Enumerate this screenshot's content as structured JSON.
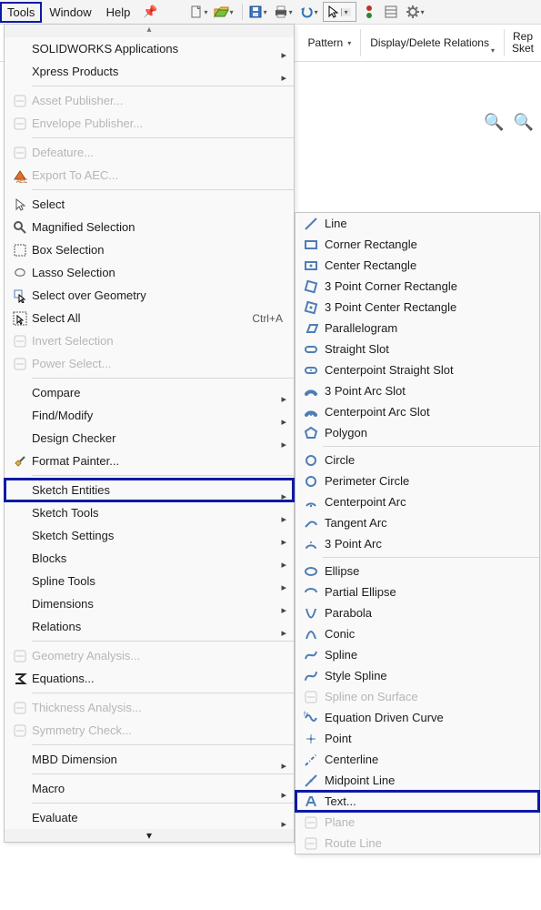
{
  "menubar": {
    "items": [
      "Tools",
      "Window",
      "Help"
    ],
    "selected_index": 0
  },
  "ribbon": {
    "pattern_label": "Pattern",
    "ddr_label": "Display/Delete Relations",
    "repair_top": "Rep",
    "repair_bottom": "Sket"
  },
  "tools_menu": {
    "scroll_up": "▴",
    "scroll_dn": "▾",
    "groups": [
      [
        {
          "label": "SOLIDWORKS Applications",
          "submenu": true
        },
        {
          "label": "Xpress Products",
          "submenu": true
        }
      ],
      [
        {
          "label": "Asset Publisher...",
          "disabled": true,
          "icon": "asset-publisher-icon"
        },
        {
          "label": "Envelope Publisher...",
          "disabled": true,
          "icon": "envelope-publisher-icon"
        }
      ],
      [
        {
          "label": "Defeature...",
          "disabled": true,
          "icon": "defeature-icon"
        },
        {
          "label": "Export To AEC...",
          "disabled": true,
          "icon": "export-aec-icon"
        }
      ],
      [
        {
          "label": "Select",
          "icon": "cursor-icon"
        },
        {
          "label": "Magnified Selection",
          "icon": "magnify-icon"
        },
        {
          "label": "Box Selection",
          "icon": "box-select-icon"
        },
        {
          "label": "Lasso Selection",
          "icon": "lasso-icon"
        },
        {
          "label": "Select over Geometry",
          "icon": "select-geometry-icon"
        },
        {
          "label": "Select All",
          "icon": "select-all-icon",
          "shortcut": "Ctrl+A"
        },
        {
          "label": "Invert Selection",
          "disabled": true,
          "icon": "invert-selection-icon"
        },
        {
          "label": "Power Select...",
          "disabled": true,
          "icon": "power-select-icon"
        }
      ],
      [
        {
          "label": "Compare",
          "submenu": true
        },
        {
          "label": "Find/Modify",
          "submenu": true
        },
        {
          "label": "Design Checker",
          "submenu": true
        },
        {
          "label": "Format Painter...",
          "icon": "format-painter-icon"
        }
      ],
      [
        {
          "label": "Sketch Entities",
          "submenu": true,
          "highlight": true
        },
        {
          "label": "Sketch Tools",
          "submenu": true
        },
        {
          "label": "Sketch Settings",
          "submenu": true
        },
        {
          "label": "Blocks",
          "submenu": true
        },
        {
          "label": "Spline Tools",
          "submenu": true
        },
        {
          "label": "Dimensions",
          "submenu": true
        },
        {
          "label": "Relations",
          "submenu": true
        }
      ],
      [
        {
          "label": "Geometry Analysis...",
          "disabled": true,
          "icon": "geometry-analysis-icon"
        },
        {
          "label": "Equations...",
          "icon": "sigma-icon"
        }
      ],
      [
        {
          "label": "Thickness Analysis...",
          "disabled": true,
          "icon": "thickness-icon"
        },
        {
          "label": "Symmetry Check...",
          "disabled": true,
          "icon": "symmetry-icon"
        }
      ],
      [
        {
          "label": "MBD Dimension",
          "submenu": true
        }
      ],
      [
        {
          "label": "Macro",
          "submenu": true
        }
      ],
      [
        {
          "label": "Evaluate",
          "submenu": true
        }
      ]
    ]
  },
  "sketch_entities": {
    "groups": [
      [
        {
          "label": "Line",
          "icon": "line-icon"
        },
        {
          "label": "Corner Rectangle",
          "icon": "corner-rect-icon"
        },
        {
          "label": "Center Rectangle",
          "icon": "center-rect-icon"
        },
        {
          "label": "3 Point Corner Rectangle",
          "icon": "3pt-corner-rect-icon"
        },
        {
          "label": "3 Point Center Rectangle",
          "icon": "3pt-center-rect-icon"
        },
        {
          "label": "Parallelogram",
          "icon": "parallelogram-icon"
        },
        {
          "label": "Straight Slot",
          "icon": "straight-slot-icon"
        },
        {
          "label": "Centerpoint Straight Slot",
          "icon": "cp-straight-slot-icon"
        },
        {
          "label": "3 Point Arc Slot",
          "icon": "3pt-arc-slot-icon"
        },
        {
          "label": "Centerpoint Arc Slot",
          "icon": "cp-arc-slot-icon"
        },
        {
          "label": "Polygon",
          "icon": "polygon-icon"
        }
      ],
      [
        {
          "label": "Circle",
          "icon": "circle-icon"
        },
        {
          "label": "Perimeter Circle",
          "icon": "perimeter-circle-icon"
        },
        {
          "label": "Centerpoint Arc",
          "icon": "centerpoint-arc-icon"
        },
        {
          "label": "Tangent Arc",
          "icon": "tangent-arc-icon"
        },
        {
          "label": "3 Point Arc",
          "icon": "3pt-arc-icon"
        }
      ],
      [
        {
          "label": "Ellipse",
          "icon": "ellipse-icon"
        },
        {
          "label": "Partial Ellipse",
          "icon": "partial-ellipse-icon"
        },
        {
          "label": "Parabola",
          "icon": "parabola-icon"
        },
        {
          "label": "Conic",
          "icon": "conic-icon"
        },
        {
          "label": "Spline",
          "icon": "spline-icon"
        },
        {
          "label": "Style Spline",
          "icon": "style-spline-icon"
        },
        {
          "label": "Spline on Surface",
          "icon": "spline-surface-icon",
          "disabled": true
        },
        {
          "label": "Equation Driven Curve",
          "icon": "equation-curve-icon"
        },
        {
          "label": "Point",
          "icon": "point-icon"
        },
        {
          "label": "Centerline",
          "icon": "centerline-icon"
        },
        {
          "label": "Midpoint Line",
          "icon": "midpoint-line-icon"
        },
        {
          "label": "Text...",
          "icon": "text-icon",
          "highlight": true
        },
        {
          "label": "Plane",
          "icon": "plane-icon",
          "disabled": true
        },
        {
          "label": "Route Line",
          "icon": "route-line-icon",
          "disabled": true
        }
      ]
    ]
  }
}
